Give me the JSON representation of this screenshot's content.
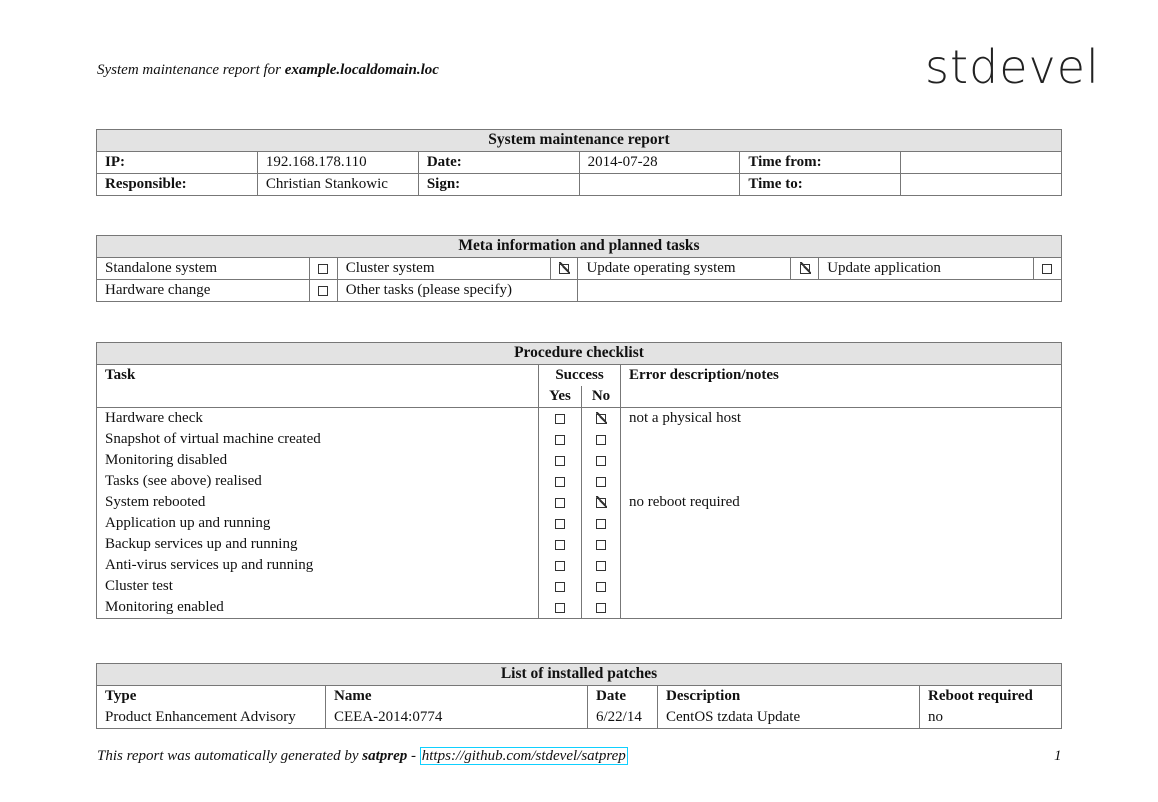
{
  "header": {
    "prefix": "System maintenance report for ",
    "host": "example.localdomain.loc",
    "logo": "stdevel"
  },
  "report": {
    "title": "System maintenance report",
    "ip_label": "IP:",
    "ip": "192.168.178.110",
    "date_label": "Date:",
    "date": "2014-07-28",
    "time_from_label": "Time from:",
    "time_from": "",
    "responsible_label": "Responsible:",
    "responsible": "Christian Stankowic",
    "sign_label": "Sign:",
    "sign": "",
    "time_to_label": "Time to:",
    "time_to": ""
  },
  "meta": {
    "title": "Meta information and planned tasks",
    "standalone": {
      "label": "Standalone system",
      "checked": false
    },
    "cluster": {
      "label": "Cluster system",
      "checked": true
    },
    "update_os": {
      "label": "Update operating system",
      "checked": true
    },
    "update_app": {
      "label": "Update application",
      "checked": false
    },
    "hardware": {
      "label": "Hardware change",
      "checked": false
    },
    "other": {
      "label": "Other tasks (please specify)",
      "value": ""
    }
  },
  "checklist": {
    "title": "Procedure checklist",
    "col_task": "Task",
    "col_success": "Success",
    "col_yes": "Yes",
    "col_no": "No",
    "col_notes": "Error description/notes",
    "rows": [
      {
        "task": "Hardware check",
        "yes": false,
        "no": true,
        "note": "not a physical host"
      },
      {
        "task": "Snapshot of virtual machine created",
        "yes": false,
        "no": false,
        "note": ""
      },
      {
        "task": "Monitoring disabled",
        "yes": false,
        "no": false,
        "note": ""
      },
      {
        "task": "Tasks (see above) realised",
        "yes": false,
        "no": false,
        "note": ""
      },
      {
        "task": "System rebooted",
        "yes": false,
        "no": true,
        "note": "no reboot required"
      },
      {
        "task": "Application up and running",
        "yes": false,
        "no": false,
        "note": ""
      },
      {
        "task": "Backup services up and running",
        "yes": false,
        "no": false,
        "note": ""
      },
      {
        "task": "Anti-virus services up and running",
        "yes": false,
        "no": false,
        "note": ""
      },
      {
        "task": "Cluster test",
        "yes": false,
        "no": false,
        "note": ""
      },
      {
        "task": "Monitoring enabled",
        "yes": false,
        "no": false,
        "note": ""
      }
    ]
  },
  "patches": {
    "title": "List of installed patches",
    "col_type": "Type",
    "col_name": "Name",
    "col_date": "Date",
    "col_desc": "Description",
    "col_reboot": "Reboot required",
    "rows": [
      {
        "type": "Product Enhancement Advisory",
        "name": "CEEA-2014:0774",
        "date": "6/22/14",
        "desc": "CentOS tzdata Update",
        "reboot": "no"
      }
    ]
  },
  "footer": {
    "text": "This report was automatically generated by ",
    "tool": "satprep",
    "sep": " - ",
    "url": "https://github.com/stdevel/satprep",
    "page": "1"
  }
}
